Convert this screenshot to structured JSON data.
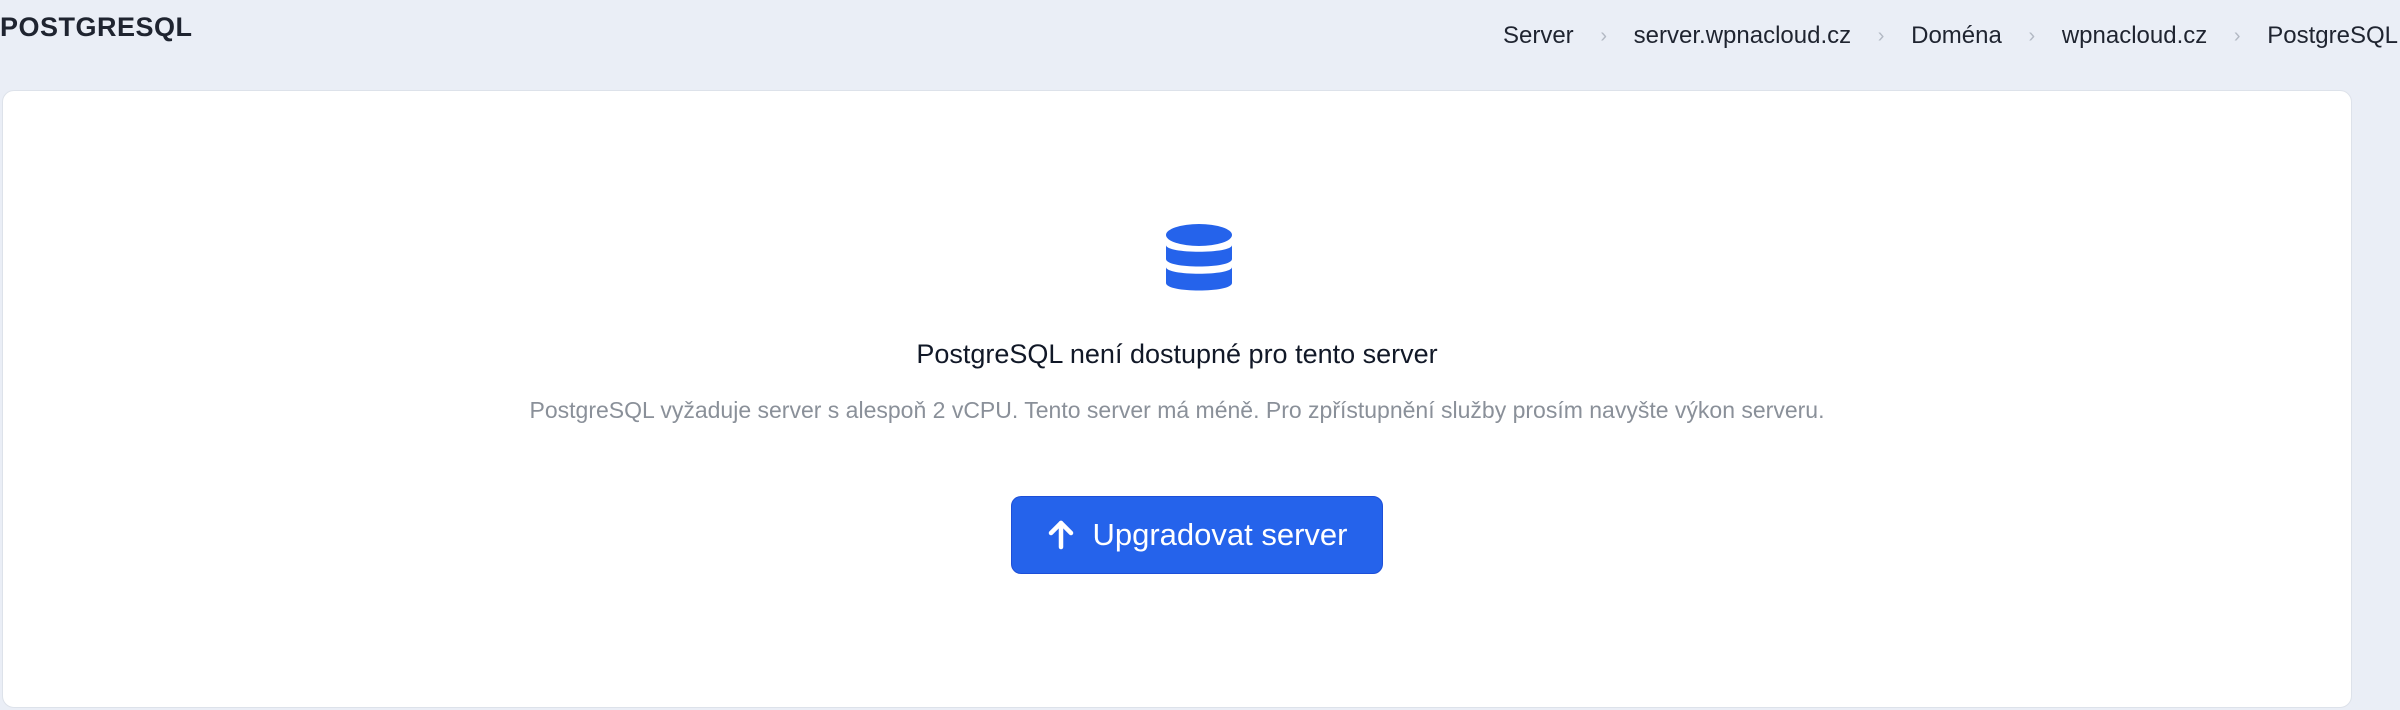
{
  "header": {
    "title": "POSTGRESQL",
    "breadcrumb": [
      {
        "label": "Server"
      },
      {
        "label": "server.wpnacloud.cz"
      },
      {
        "label": "Doména"
      },
      {
        "label": "wpnacloud.cz"
      },
      {
        "label": "PostgreSQL"
      }
    ],
    "separator": "›"
  },
  "empty_state": {
    "icon": "database-icon",
    "title": "PostgreSQL není dostupné pro tento server",
    "description": "PostgreSQL vyžaduje server s alespoň 2 vCPU. Tento server má méně. Pro zpřístupnění služby prosím navyšte výkon serveru.",
    "button": {
      "icon": "arrow-up-icon",
      "label": "Upgradovat server"
    }
  },
  "colors": {
    "accent": "#2563eb",
    "page_background": "#eaeef6",
    "card_background": "#ffffff",
    "muted_text": "#8a9099"
  }
}
